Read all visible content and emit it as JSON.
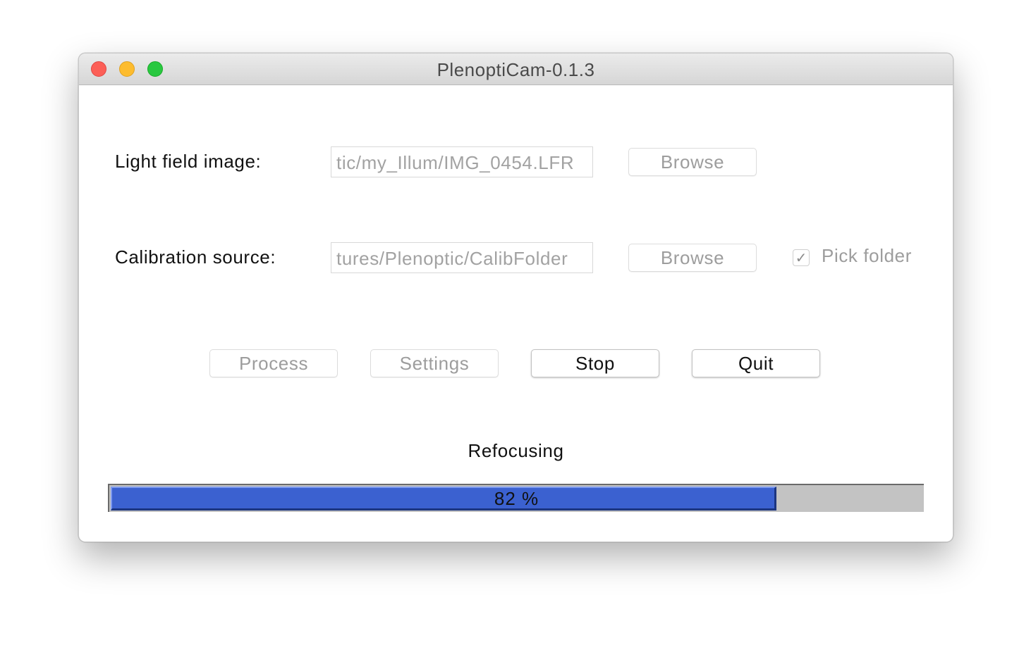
{
  "window": {
    "title": "PlenoptiCam-0.1.3"
  },
  "light_field": {
    "label": "Light field image:",
    "value": "tic/my_Illum/IMG_0454.LFR",
    "browse_label": "Browse"
  },
  "calibration": {
    "label": "Calibration source:",
    "value": "tures/Plenoptic/CalibFolder",
    "browse_label": "Browse",
    "pick_folder_label": "Pick folder",
    "pick_folder_checked": true
  },
  "actions": {
    "process_label": "Process",
    "settings_label": "Settings",
    "stop_label": "Stop",
    "quit_label": "Quit"
  },
  "status": {
    "text": "Refocusing",
    "progress_percent": 82,
    "progress_label": "82 %"
  },
  "colors": {
    "progress_fill": "#3b61d0",
    "progress_track": "#c3c3c3",
    "close": "#fc5f57",
    "minimize": "#fdbc2e",
    "maximize": "#29c840"
  }
}
